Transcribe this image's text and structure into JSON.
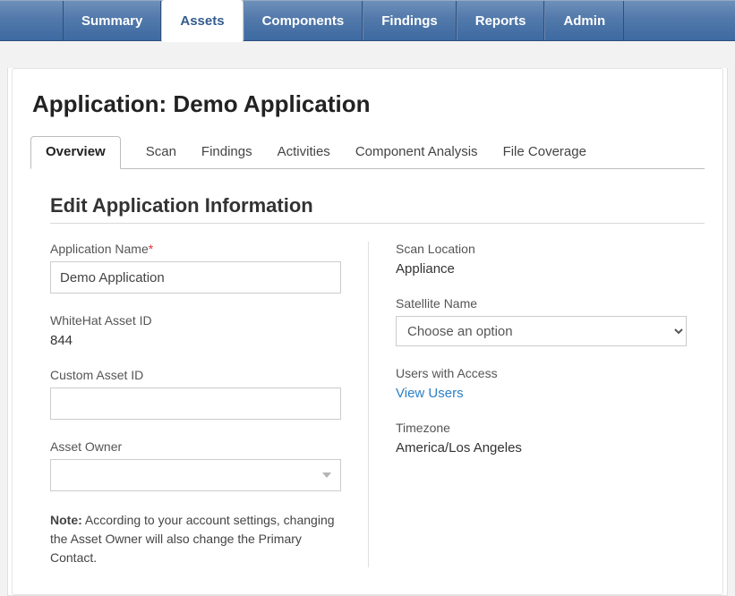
{
  "topnav": {
    "items": [
      {
        "label": "Summary"
      },
      {
        "label": "Assets"
      },
      {
        "label": "Components"
      },
      {
        "label": "Findings"
      },
      {
        "label": "Reports"
      },
      {
        "label": "Admin"
      }
    ],
    "active_index": 1
  },
  "page_title": "Application: Demo Application",
  "subtabs": {
    "items": [
      {
        "label": "Overview"
      },
      {
        "label": "Scan"
      },
      {
        "label": "Findings"
      },
      {
        "label": "Activities"
      },
      {
        "label": "Component Analysis"
      },
      {
        "label": "File Coverage"
      }
    ],
    "active_index": 0
  },
  "section_title": "Edit Application Information",
  "left": {
    "app_name_label": "Application Name",
    "app_name_value": "Demo Application",
    "asset_id_label": "WhiteHat Asset ID",
    "asset_id_value": "844",
    "custom_asset_id_label": "Custom Asset ID",
    "custom_asset_id_value": "",
    "asset_owner_label": "Asset Owner",
    "asset_owner_value": "",
    "note_prefix": "Note:",
    "note_body": " According to your account settings, changing the Asset Owner will also change the Primary Contact."
  },
  "right": {
    "scan_location_label": "Scan Location",
    "scan_location_value": "Appliance",
    "satellite_label": "Satellite Name",
    "satellite_placeholder": "Choose an option",
    "users_label": "Users with Access",
    "view_users": "View Users",
    "timezone_label": "Timezone",
    "timezone_value": "America/Los Angeles"
  }
}
